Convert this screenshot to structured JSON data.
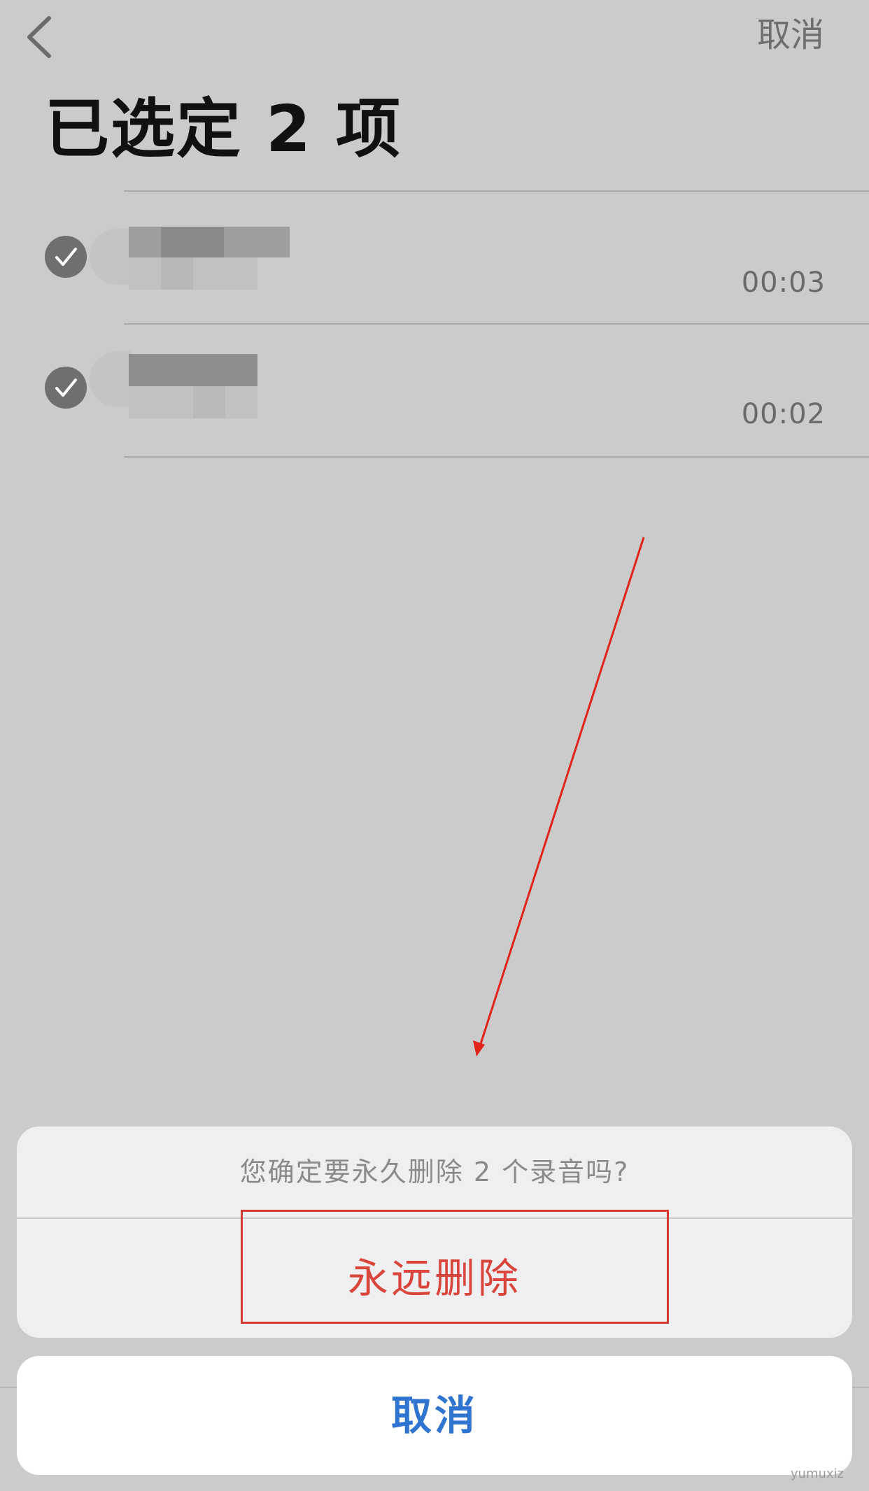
{
  "nav": {
    "back_icon": "chevron-left-icon",
    "cancel_label": "取消"
  },
  "header": {
    "title": "已选定 2 项"
  },
  "recordings": [
    {
      "selected": true,
      "title": "",
      "duration": "00:03"
    },
    {
      "selected": true,
      "title": "",
      "duration": "00:02"
    }
  ],
  "action_sheet": {
    "message": "您确定要永久删除 2 个录音吗?",
    "delete_label": "永远删除",
    "cancel_label": "取消"
  },
  "colors": {
    "destructive": "#d9453a",
    "primary": "#2f74d0",
    "annotation": "#e0241b"
  },
  "watermark": "yumuxiz"
}
